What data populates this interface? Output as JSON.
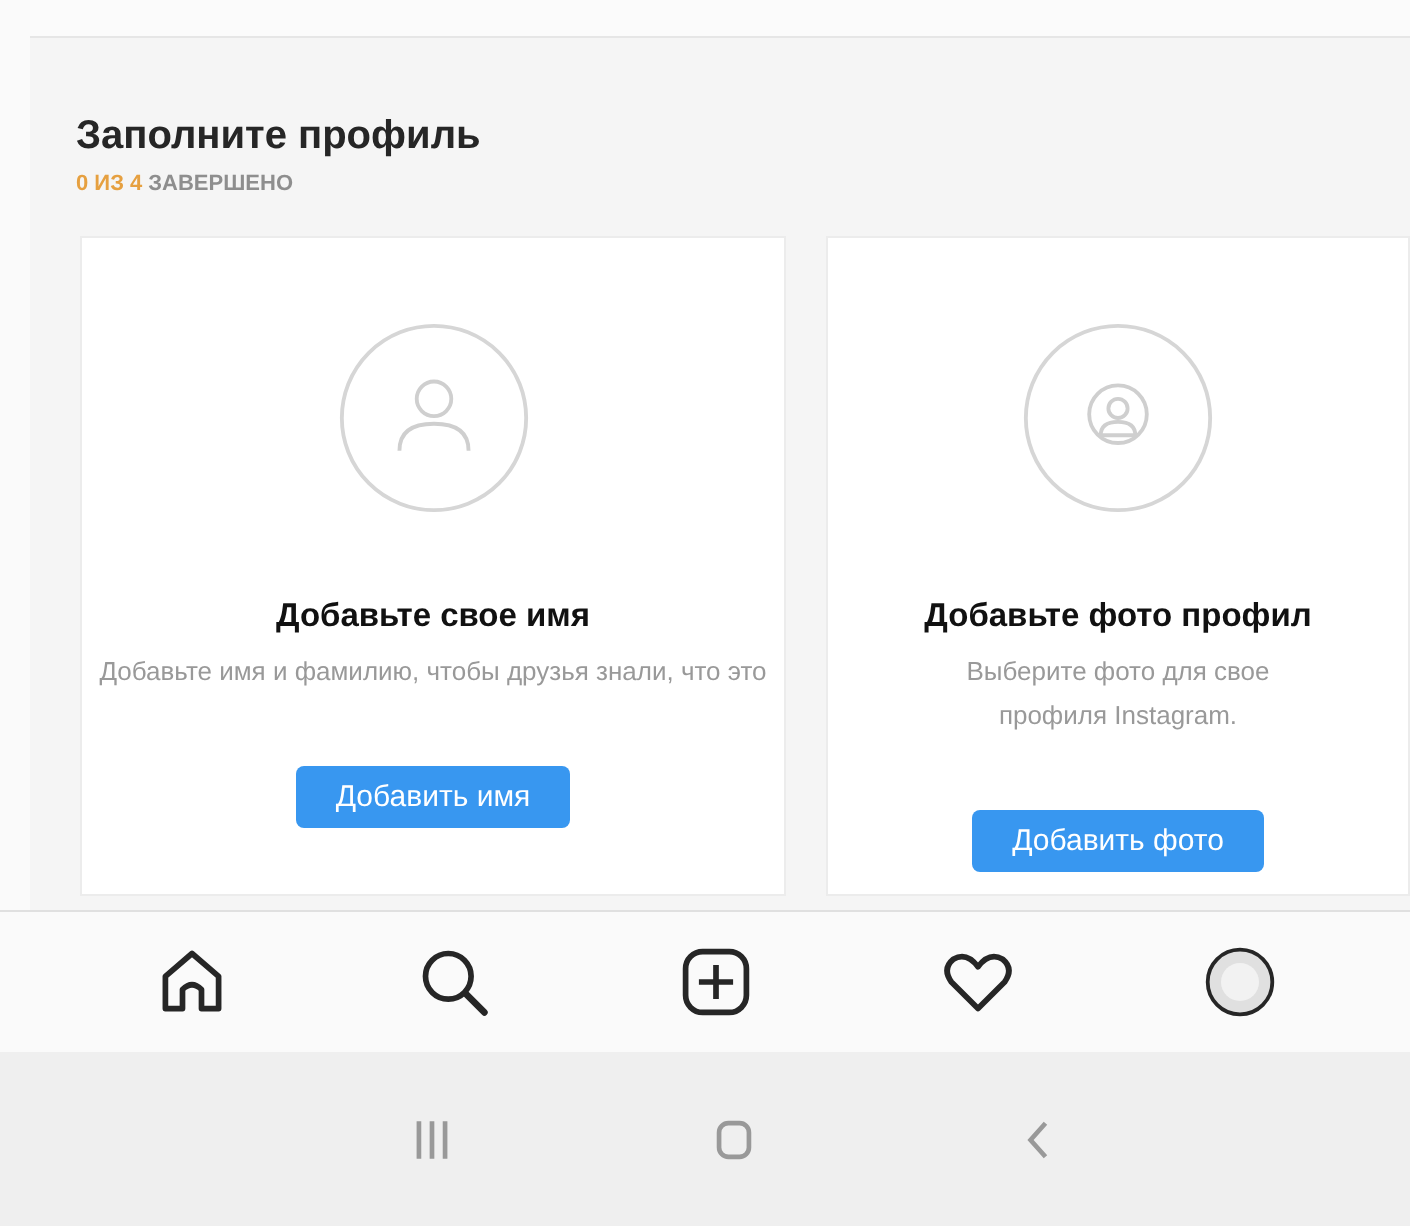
{
  "profile_setup": {
    "title": "Заполните профиль",
    "progress_count": "0 ИЗ 4",
    "progress_label": "ЗАВЕРШЕНО",
    "cards": [
      {
        "kind": "name",
        "title": "Добавьте свое имя",
        "description": "Добавьте имя и фамилию, чтобы друзья знали, что это",
        "button": "Добавить имя"
      },
      {
        "kind": "photo",
        "title": "Добавьте фото профил",
        "description_lines": [
          "Выберите фото для свое",
          "профиля Instagram."
        ],
        "button": "Добавить фото"
      }
    ]
  },
  "bottom_nav": [
    {
      "kind": "home"
    },
    {
      "kind": "search"
    },
    {
      "kind": "create"
    },
    {
      "kind": "activity"
    },
    {
      "kind": "profile"
    }
  ],
  "system_nav": [
    {
      "kind": "recents"
    },
    {
      "kind": "home"
    },
    {
      "kind": "back"
    }
  ]
}
